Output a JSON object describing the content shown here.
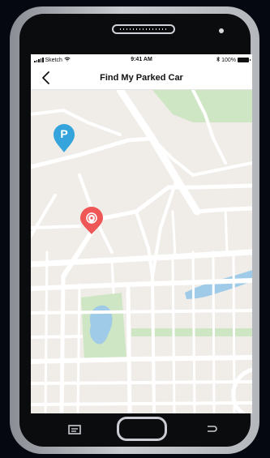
{
  "status_bar": {
    "carrier": "Sketch",
    "time": "9:41 AM",
    "battery": "100%",
    "bluetooth_icon": "bluetooth-icon",
    "wifi_icon": "wifi-icon",
    "battery_icon": "battery-icon"
  },
  "header": {
    "title": "Find My Parked Car",
    "back_icon": "chevron-left-icon"
  },
  "map": {
    "parking_marker": {
      "label": "P",
      "color": "#36a4dc",
      "icon": "parking-pin-icon"
    },
    "location_marker": {
      "color": "#ef5757",
      "icon": "location-pin-icon"
    },
    "colors": {
      "land": "#f0ede8",
      "road": "#ffffff",
      "park": "#cfe6c4",
      "water": "#9fcbe9"
    }
  },
  "device": {
    "menu_icon": "menu-icon",
    "home_icon": "home-button-icon",
    "return_icon": "return-icon"
  }
}
